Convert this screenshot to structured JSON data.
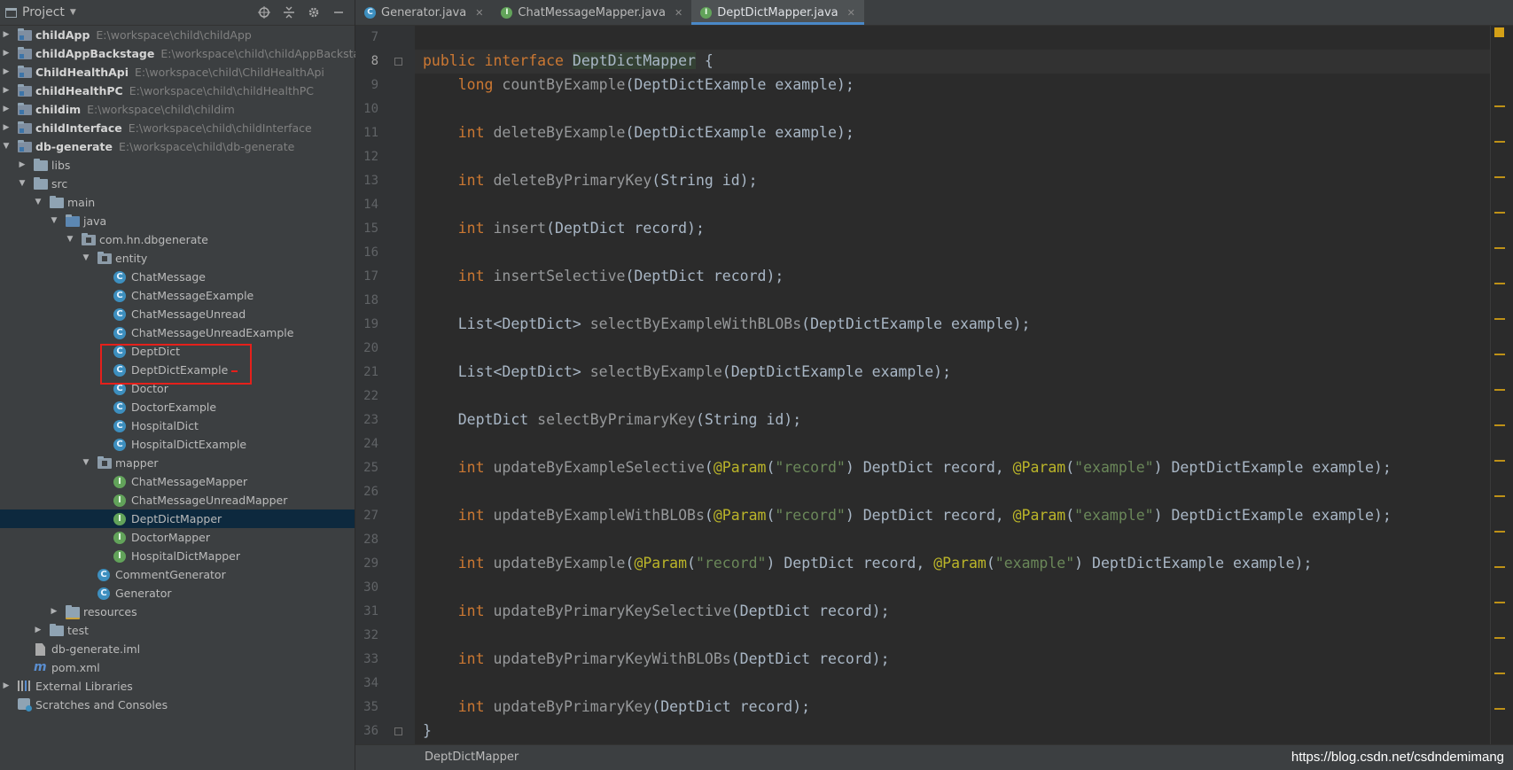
{
  "project_panel": {
    "title": "Project",
    "tree": [
      {
        "label": "childApp",
        "path": "E:\\workspace\\child\\childApp",
        "bold": true,
        "kind": "module",
        "depth": 0,
        "arrow": "right"
      },
      {
        "label": "childAppBackstage",
        "path": "E:\\workspace\\child\\childAppBackstage",
        "bold": true,
        "kind": "module",
        "depth": 0,
        "arrow": "right"
      },
      {
        "label": "ChildHealthApi",
        "path": "E:\\workspace\\child\\ChildHealthApi",
        "bold": true,
        "kind": "module",
        "depth": 0,
        "arrow": "right"
      },
      {
        "label": "childHealthPC",
        "path": "E:\\workspace\\child\\childHealthPC",
        "bold": true,
        "kind": "module",
        "depth": 0,
        "arrow": "right"
      },
      {
        "label": "childim",
        "path": "E:\\workspace\\child\\childim",
        "bold": true,
        "kind": "module",
        "depth": 0,
        "arrow": "right"
      },
      {
        "label": "childInterface",
        "path": "E:\\workspace\\child\\childInterface",
        "bold": true,
        "kind": "module",
        "depth": 0,
        "arrow": "right"
      },
      {
        "label": "db-generate",
        "path": "E:\\workspace\\child\\db-generate",
        "bold": true,
        "kind": "module",
        "depth": 0,
        "arrow": "down"
      },
      {
        "label": "libs",
        "kind": "folder",
        "depth": 1,
        "arrow": "right"
      },
      {
        "label": "src",
        "kind": "folder",
        "depth": 1,
        "arrow": "down"
      },
      {
        "label": "main",
        "kind": "folder",
        "depth": 2,
        "arrow": "down"
      },
      {
        "label": "java",
        "kind": "folder-blue",
        "depth": 3,
        "arrow": "down"
      },
      {
        "label": "com.hn.dbgenerate",
        "kind": "package",
        "depth": 4,
        "arrow": "down"
      },
      {
        "label": "entity",
        "kind": "package",
        "depth": 5,
        "arrow": "down"
      },
      {
        "label": "ChatMessage",
        "kind": "class",
        "depth": 6
      },
      {
        "label": "ChatMessageExample",
        "kind": "class",
        "depth": 6
      },
      {
        "label": "ChatMessageUnread",
        "kind": "class",
        "depth": 6
      },
      {
        "label": "ChatMessageUnreadExample",
        "kind": "class",
        "depth": 6
      },
      {
        "label": "DeptDict",
        "kind": "class",
        "depth": 6
      },
      {
        "label": "DeptDictExample",
        "kind": "class",
        "depth": 6
      },
      {
        "label": "Doctor",
        "kind": "class",
        "depth": 6
      },
      {
        "label": "DoctorExample",
        "kind": "class",
        "depth": 6
      },
      {
        "label": "HospitalDict",
        "kind": "class",
        "depth": 6
      },
      {
        "label": "HospitalDictExample",
        "kind": "class",
        "depth": 6
      },
      {
        "label": "mapper",
        "kind": "package",
        "depth": 5,
        "arrow": "down"
      },
      {
        "label": "ChatMessageMapper",
        "kind": "interface",
        "depth": 6
      },
      {
        "label": "ChatMessageUnreadMapper",
        "kind": "interface",
        "depth": 6
      },
      {
        "label": "DeptDictMapper",
        "kind": "interface",
        "depth": 6,
        "selected": true
      },
      {
        "label": "DoctorMapper",
        "kind": "interface",
        "depth": 6
      },
      {
        "label": "HospitalDictMapper",
        "kind": "interface",
        "depth": 6
      },
      {
        "label": "CommentGenerator",
        "kind": "class",
        "depth": 5
      },
      {
        "label": "Generator",
        "kind": "class-run",
        "depth": 5
      },
      {
        "label": "resources",
        "kind": "folder-res",
        "depth": 3,
        "arrow": "right"
      },
      {
        "label": "test",
        "kind": "folder",
        "depth": 2,
        "arrow": "right"
      },
      {
        "label": "db-generate.iml",
        "kind": "file",
        "depth": 1
      },
      {
        "label": "pom.xml",
        "kind": "maven",
        "depth": 1
      },
      {
        "label": "External Libraries",
        "kind": "libs",
        "depth": 0,
        "arrow": "right"
      },
      {
        "label": "Scratches and Consoles",
        "kind": "scratch",
        "depth": 0
      }
    ]
  },
  "tabs": [
    {
      "label": "Generator.java",
      "icon": "class",
      "active": false
    },
    {
      "label": "ChatMessageMapper.java",
      "icon": "interface",
      "active": false
    },
    {
      "label": "DeptDictMapper.java",
      "icon": "interface",
      "active": true
    }
  ],
  "editor": {
    "current_line": 8,
    "lines": [
      {
        "n": "7",
        "segs": []
      },
      {
        "n": "8",
        "segs": [
          [
            "kw",
            "public interface "
          ],
          [
            "ifn",
            "DeptDictMapper"
          ],
          [
            "ty",
            " {"
          ]
        ]
      },
      {
        "n": "9",
        "segs": [
          [
            "kw",
            "    long "
          ],
          [
            "fn",
            "countByExample"
          ],
          [
            "ty",
            "(DeptDictExample example);"
          ]
        ]
      },
      {
        "n": "10",
        "segs": []
      },
      {
        "n": "11",
        "segs": [
          [
            "kw",
            "    int "
          ],
          [
            "fn",
            "deleteByExample"
          ],
          [
            "ty",
            "(DeptDictExample example);"
          ]
        ]
      },
      {
        "n": "12",
        "segs": []
      },
      {
        "n": "13",
        "segs": [
          [
            "kw",
            "    int "
          ],
          [
            "fn",
            "deleteByPrimaryKey"
          ],
          [
            "ty",
            "(String id);"
          ]
        ]
      },
      {
        "n": "14",
        "segs": []
      },
      {
        "n": "15",
        "segs": [
          [
            "kw",
            "    int "
          ],
          [
            "fn",
            "insert"
          ],
          [
            "ty",
            "(DeptDict record);"
          ]
        ]
      },
      {
        "n": "16",
        "segs": []
      },
      {
        "n": "17",
        "segs": [
          [
            "kw",
            "    int "
          ],
          [
            "fn",
            "insertSelective"
          ],
          [
            "ty",
            "(DeptDict record);"
          ]
        ]
      },
      {
        "n": "18",
        "segs": []
      },
      {
        "n": "19",
        "segs": [
          [
            "ty",
            "    List<DeptDict> "
          ],
          [
            "fn",
            "selectByExampleWithBLOBs"
          ],
          [
            "ty",
            "(DeptDictExample example);"
          ]
        ]
      },
      {
        "n": "20",
        "segs": []
      },
      {
        "n": "21",
        "segs": [
          [
            "ty",
            "    List<DeptDict> "
          ],
          [
            "fn",
            "selectByExample"
          ],
          [
            "ty",
            "(DeptDictExample example);"
          ]
        ]
      },
      {
        "n": "22",
        "segs": []
      },
      {
        "n": "23",
        "segs": [
          [
            "ty",
            "    DeptDict "
          ],
          [
            "fn",
            "selectByPrimaryKey"
          ],
          [
            "ty",
            "(String id);"
          ]
        ]
      },
      {
        "n": "24",
        "segs": []
      },
      {
        "n": "25",
        "segs": [
          [
            "kw",
            "    int "
          ],
          [
            "fn",
            "updateByExampleSelective"
          ],
          [
            "ty",
            "("
          ],
          [
            "an",
            "@Param"
          ],
          [
            "ty",
            "("
          ],
          [
            "st",
            "\"record\""
          ],
          [
            "ty",
            ") DeptDict record, "
          ],
          [
            "an",
            "@Param"
          ],
          [
            "ty",
            "("
          ],
          [
            "st",
            "\"example\""
          ],
          [
            "ty",
            ") DeptDictExample example);"
          ]
        ]
      },
      {
        "n": "26",
        "segs": []
      },
      {
        "n": "27",
        "segs": [
          [
            "kw",
            "    int "
          ],
          [
            "fn",
            "updateByExampleWithBLOBs"
          ],
          [
            "ty",
            "("
          ],
          [
            "an",
            "@Param"
          ],
          [
            "ty",
            "("
          ],
          [
            "st",
            "\"record\""
          ],
          [
            "ty",
            ") DeptDict record, "
          ],
          [
            "an",
            "@Param"
          ],
          [
            "ty",
            "("
          ],
          [
            "st",
            "\"example\""
          ],
          [
            "ty",
            ") DeptDictExample example);"
          ]
        ]
      },
      {
        "n": "28",
        "segs": []
      },
      {
        "n": "29",
        "segs": [
          [
            "kw",
            "    int "
          ],
          [
            "fn",
            "updateByExample"
          ],
          [
            "ty",
            "("
          ],
          [
            "an",
            "@Param"
          ],
          [
            "ty",
            "("
          ],
          [
            "st",
            "\"record\""
          ],
          [
            "ty",
            ") DeptDict record, "
          ],
          [
            "an",
            "@Param"
          ],
          [
            "ty",
            "("
          ],
          [
            "st",
            "\"example\""
          ],
          [
            "ty",
            ") DeptDictExample example);"
          ]
        ]
      },
      {
        "n": "30",
        "segs": []
      },
      {
        "n": "31",
        "segs": [
          [
            "kw",
            "    int "
          ],
          [
            "fn",
            "updateByPrimaryKeySelective"
          ],
          [
            "ty",
            "(DeptDict record);"
          ]
        ]
      },
      {
        "n": "32",
        "segs": []
      },
      {
        "n": "33",
        "segs": [
          [
            "kw",
            "    int "
          ],
          [
            "fn",
            "updateByPrimaryKeyWithBLOBs"
          ],
          [
            "ty",
            "(DeptDict record);"
          ]
        ]
      },
      {
        "n": "34",
        "segs": []
      },
      {
        "n": "35",
        "segs": [
          [
            "kw",
            "    int "
          ],
          [
            "fn",
            "updateByPrimaryKey"
          ],
          [
            "ty",
            "(DeptDict record);"
          ]
        ]
      },
      {
        "n": "36",
        "segs": [
          [
            "ty",
            "}"
          ]
        ]
      }
    ]
  },
  "breadcrumb": "DeptDictMapper",
  "watermark": "https://blog.csdn.net/csdndemimang",
  "colors": {
    "keyword": "#cc7832",
    "string": "#6a8759",
    "annotation": "#bbb529",
    "selection": "#0d293e",
    "highlight_box": "#e5201b"
  }
}
